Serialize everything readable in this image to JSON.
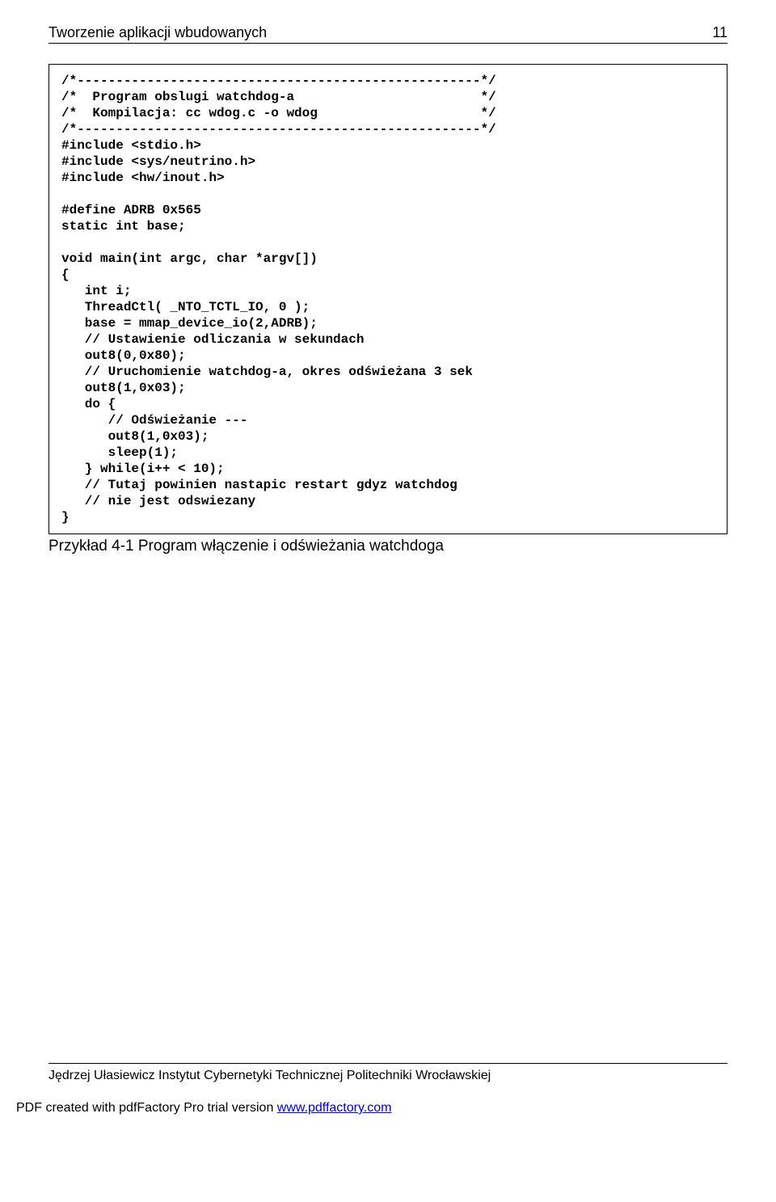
{
  "header": {
    "title": "Tworzenie aplikacji wbudowanych",
    "page": "11"
  },
  "code": "/*----------------------------------------------------*/\n/*  Program obslugi watchdog-a                        */\n/*  Kompilacja: cc wdog.c -o wdog                     */\n/*----------------------------------------------------*/\n#include <stdio.h>\n#include <sys/neutrino.h>\n#include <hw/inout.h>\n\n#define ADRB 0x565\nstatic int base;\n\nvoid main(int argc, char *argv[])\n{\n   int i;\n   ThreadCtl( _NTO_TCTL_IO, 0 );\n   base = mmap_device_io(2,ADRB);\n   // Ustawienie odliczania w sekundach\n   out8(0,0x80);\n   // Uruchomienie watchdog-a, okres odświeżana 3 sek\n   out8(1,0x03);\n   do {\n      // Odświeżanie ---\n      out8(1,0x03);\n      sleep(1);\n   } while(i++ < 10);\n   // Tutaj powinien nastapic restart gdyz watchdog\n   // nie jest odswiezany\n}",
  "caption": "Przykład 4-1  Program włączenie i odświeżania watchdoga",
  "footer": "Jędrzej Ułasiewicz Instytut Cybernetyki Technicznej Politechniki Wrocławskiej",
  "pdf": {
    "prefix": "PDF created with pdfFactory Pro trial version ",
    "link_text": "www.pdffactory.com",
    "link_href": "http://www.pdffactory.com"
  }
}
